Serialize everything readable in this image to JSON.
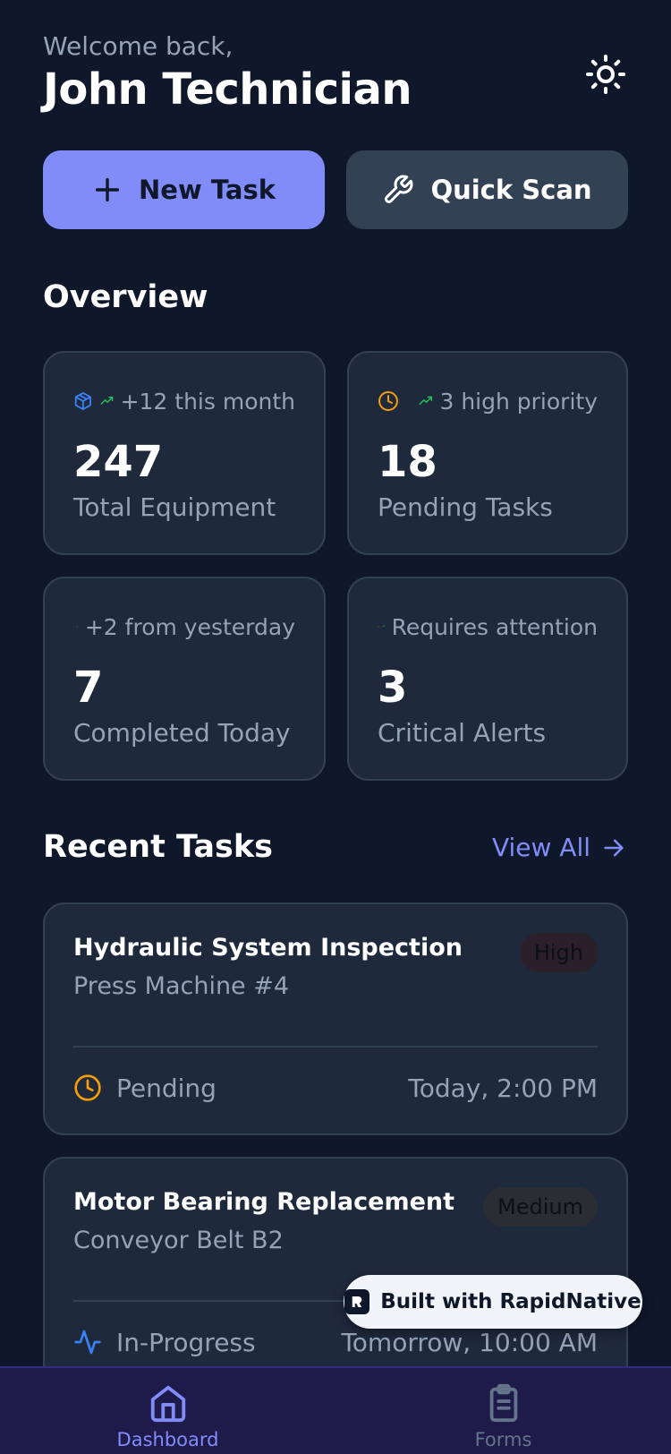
{
  "header": {
    "welcome": "Welcome back,",
    "name": "John Technician"
  },
  "actions": {
    "new_task": "New Task",
    "quick_scan": "Quick Scan"
  },
  "overview": {
    "title": "Overview",
    "stats": [
      {
        "icon": "package-icon",
        "trend": "+12 this month",
        "value": "247",
        "label": "Total Equipment",
        "icon_color": "#3b82f6"
      },
      {
        "icon": "clock-icon",
        "trend": "3 high priority",
        "value": "18",
        "label": "Pending Tasks",
        "icon_color": "#f59e0b"
      },
      {
        "icon": "check-circle-icon",
        "trend": "+2 from yesterday",
        "value": "7",
        "label": "Completed Today",
        "icon_color": "#22c55e"
      },
      {
        "icon": "alert-circle-icon",
        "trend": "Requires attention",
        "value": "3",
        "label": "Critical Alerts",
        "icon_color": "#ef4444"
      }
    ]
  },
  "recent": {
    "title": "Recent Tasks",
    "view_all": "View All",
    "tasks": [
      {
        "title": "Hydraulic System Inspection",
        "equipment": "Press Machine #4",
        "priority": "High",
        "status": "Pending",
        "due": "Today, 2:00 PM",
        "status_color": "#f59e0b"
      },
      {
        "title": "Motor Bearing Replacement",
        "equipment": "Conveyor Belt B2",
        "priority": "Medium",
        "status": "In-Progress",
        "due": "Tomorrow, 10:00 AM",
        "status_color": "#3b82f6"
      }
    ]
  },
  "built_with": "Built with RapidNative",
  "nav": {
    "items": [
      {
        "label": "Dashboard",
        "icon": "home-icon"
      },
      {
        "label": "Forms",
        "icon": "clipboard-icon"
      }
    ]
  },
  "colors": {
    "accent": "#818cf8",
    "background": "#0f172a",
    "card": "#1e293b",
    "trend_up": "#22c55e"
  }
}
